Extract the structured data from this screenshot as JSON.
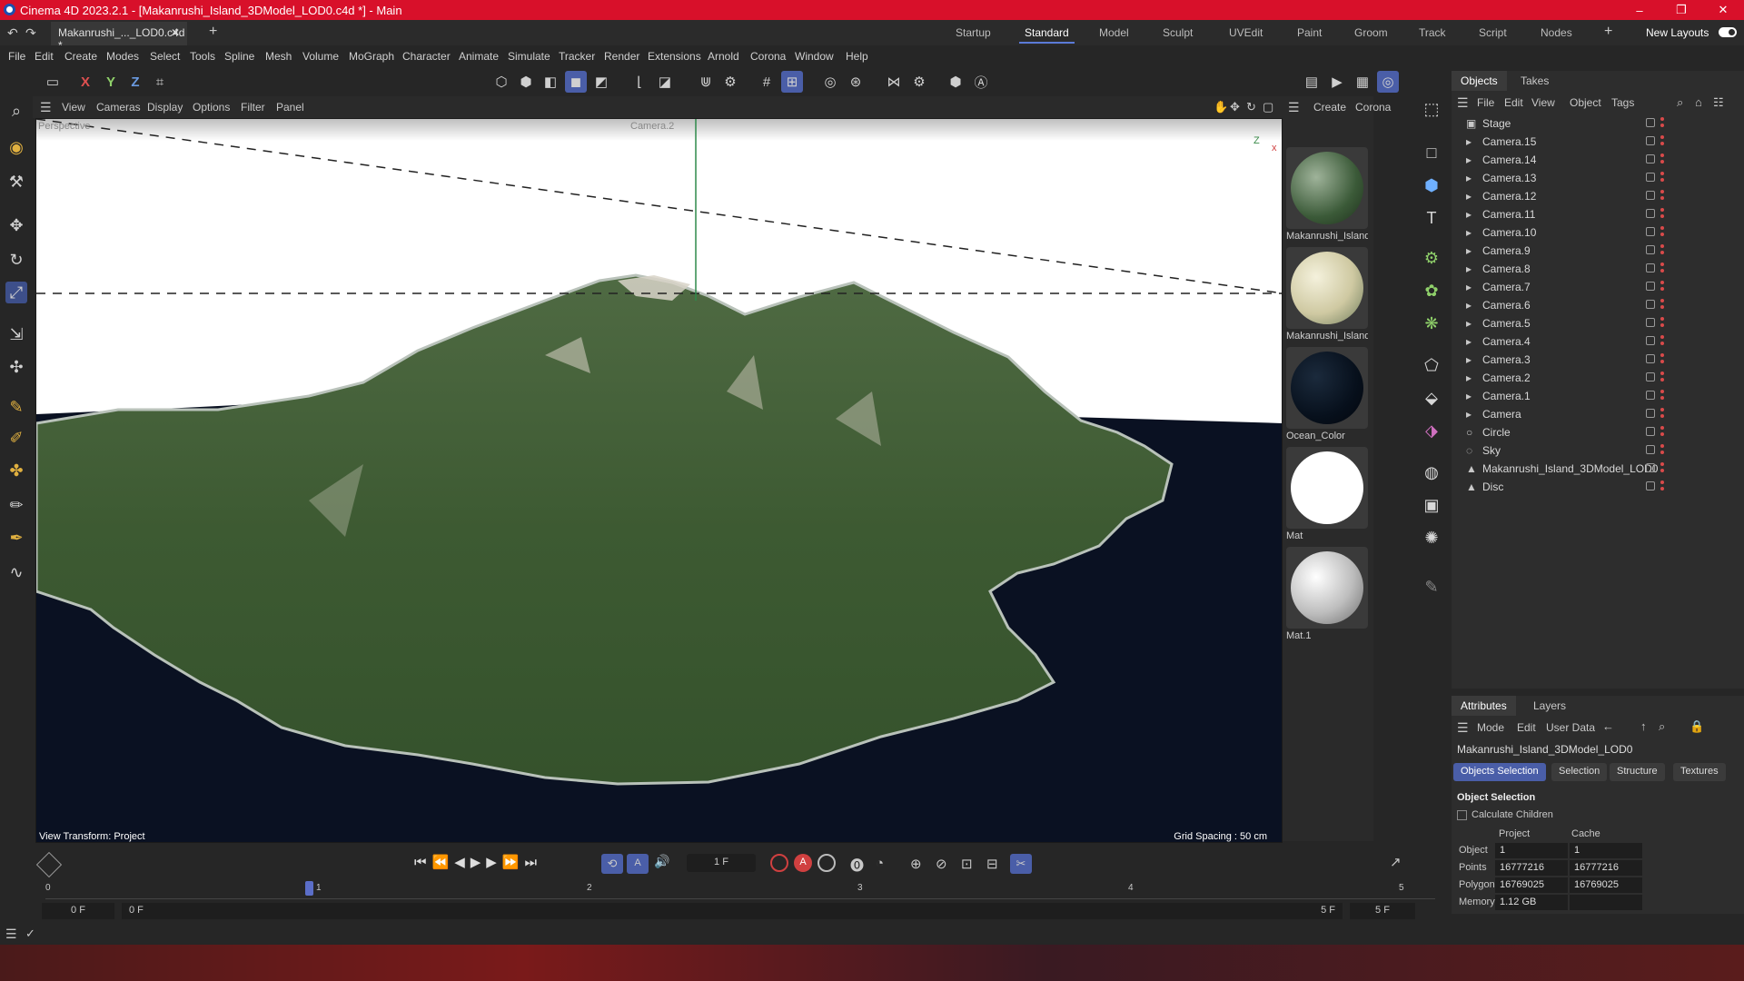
{
  "window": {
    "title": "Cinema 4D 2023.2.1 - [Makanrushi_Island_3DModel_LOD0.c4d *] - Main",
    "minimize_glyph": "–",
    "maximize_glyph": "❐",
    "close_glyph": "✕"
  },
  "tabs": {
    "doc_tab": "Makanrushi_..._LOD0.c4d *",
    "close_glyph": "✕",
    "add_glyph": "+"
  },
  "layouts": [
    {
      "label": "Startup"
    },
    {
      "label": "Standard"
    },
    {
      "label": "Model"
    },
    {
      "label": "Sculpt"
    },
    {
      "label": "UVEdit"
    },
    {
      "label": "Paint"
    },
    {
      "label": "Groom"
    },
    {
      "label": "Track"
    },
    {
      "label": "Script"
    },
    {
      "label": "Nodes"
    }
  ],
  "new_layouts": "New Layouts",
  "menu": [
    "File",
    "Edit",
    "Create",
    "Modes",
    "Select",
    "Tools",
    "Spline",
    "Mesh",
    "Volume",
    "MoGraph",
    "Character",
    "Animate",
    "Simulate",
    "Tracker",
    "Render",
    "Extensions",
    "Arnold",
    "Corona",
    "Window",
    "Help"
  ],
  "axis_toggles": {
    "x": "X",
    "y": "Y",
    "z": "Z"
  },
  "viewport": {
    "menu": [
      "View",
      "Cameras",
      "Display",
      "Options",
      "Filter",
      "Panel"
    ],
    "label": "Perspective",
    "camera_label": "Camera.2",
    "view_transform": "View Transform: Project",
    "grid_spacing": "Grid Spacing : 50 cm",
    "axis_z": "Z",
    "axis_x": "x"
  },
  "materials": {
    "menu": [
      "Create",
      "Corona"
    ],
    "items": [
      {
        "name": "Makanrushi_Island"
      },
      {
        "name": "Makanrushi_Island"
      },
      {
        "name": "Ocean_Color"
      },
      {
        "name": "Mat"
      },
      {
        "name": "Mat.1"
      }
    ]
  },
  "objects_panel": {
    "tabs": [
      "Objects",
      "Takes"
    ],
    "menu": [
      "File",
      "Edit",
      "View",
      "Object",
      "Tags"
    ],
    "items": [
      {
        "name": "Stage",
        "icon": "stage-icon",
        "glyph": "▣"
      },
      {
        "name": "Camera.15",
        "icon": "camera-icon",
        "glyph": "▸"
      },
      {
        "name": "Camera.14",
        "icon": "camera-icon",
        "glyph": "▸"
      },
      {
        "name": "Camera.13",
        "icon": "camera-icon",
        "glyph": "▸"
      },
      {
        "name": "Camera.12",
        "icon": "camera-icon",
        "glyph": "▸"
      },
      {
        "name": "Camera.11",
        "icon": "camera-icon",
        "glyph": "▸"
      },
      {
        "name": "Camera.10",
        "icon": "camera-icon",
        "glyph": "▸"
      },
      {
        "name": "Camera.9",
        "icon": "camera-icon",
        "glyph": "▸"
      },
      {
        "name": "Camera.8",
        "icon": "camera-icon",
        "glyph": "▸"
      },
      {
        "name": "Camera.7",
        "icon": "camera-icon",
        "glyph": "▸"
      },
      {
        "name": "Camera.6",
        "icon": "camera-icon",
        "glyph": "▸"
      },
      {
        "name": "Camera.5",
        "icon": "camera-icon",
        "glyph": "▸"
      },
      {
        "name": "Camera.4",
        "icon": "camera-icon",
        "glyph": "▸"
      },
      {
        "name": "Camera.3",
        "icon": "camera-icon",
        "glyph": "▸"
      },
      {
        "name": "Camera.2",
        "icon": "camera-icon",
        "glyph": "▸"
      },
      {
        "name": "Camera.1",
        "icon": "camera-icon",
        "glyph": "▸"
      },
      {
        "name": "Camera",
        "icon": "camera-icon",
        "glyph": "▸"
      },
      {
        "name": "Circle",
        "icon": "circle-icon",
        "glyph": "○"
      },
      {
        "name": "Sky",
        "icon": "sky-icon",
        "glyph": "◌"
      },
      {
        "name": "Makanrushi_Island_3DModel_LOD0",
        "icon": "polygon-icon",
        "glyph": "▲"
      },
      {
        "name": "Disc",
        "icon": "polygon-icon",
        "glyph": "▲"
      }
    ]
  },
  "attributes_panel": {
    "tabs": [
      "Attributes",
      "Layers"
    ],
    "menu": [
      "Mode",
      "Edit",
      "User Data"
    ],
    "object_name": "Makanrushi_Island_3DModel_LOD0",
    "chips": [
      "Objects Selection",
      "Selection",
      "Structure",
      "Textures"
    ],
    "section_title": "Object Selection",
    "calculate_children": "Calculate Children",
    "columns": [
      "Project",
      "Cache"
    ],
    "rows": [
      {
        "label": "Object",
        "project": "1",
        "cache": "1"
      },
      {
        "label": "Points",
        "project": "16777216",
        "cache": "16777216"
      },
      {
        "label": "Polygons",
        "project": "16769025",
        "cache": "16769025"
      },
      {
        "label": "Memory",
        "project": "1.12 GB",
        "cache": ""
      }
    ]
  },
  "timeline": {
    "current_frame": "1 F",
    "start_field": "0 F",
    "start_field2": "0 F",
    "end_field": "5 F",
    "end_field2": "5 F",
    "ticks": [
      "0",
      "1",
      "2",
      "3",
      "4",
      "5"
    ],
    "record_label": "A"
  },
  "colors": {
    "titlebar": "#d8102a",
    "accent": "#4a5ea8",
    "ocean": "#0a1122",
    "terrain": "#3d5a32"
  }
}
